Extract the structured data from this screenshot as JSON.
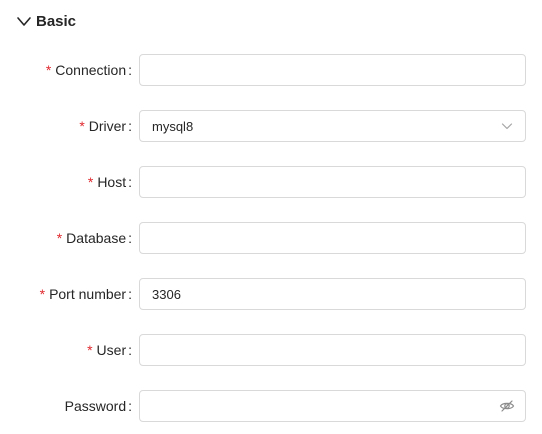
{
  "section": {
    "title": "Basic",
    "expand_icon": "chevron-down-icon"
  },
  "fields": {
    "connection": {
      "label": "Connection",
      "required": "*",
      "colon": ":",
      "value": ""
    },
    "driver": {
      "label": "Driver",
      "required": "*",
      "colon": ":",
      "value": "mysql8",
      "suffix_icon": "chevron-down-icon"
    },
    "host": {
      "label": "Host",
      "required": "*",
      "colon": ":",
      "value": ""
    },
    "database": {
      "label": "Database",
      "required": "*",
      "colon": ":",
      "value": ""
    },
    "port": {
      "label": "Port number",
      "required": "*",
      "colon": ":",
      "value": "3306"
    },
    "user": {
      "label": "User",
      "required": "*",
      "colon": ":",
      "value": ""
    },
    "password": {
      "label": "Password",
      "colon": ":",
      "value": "",
      "suffix_icon": "eye-invisible-icon"
    }
  },
  "colors": {
    "required": "#e0282e",
    "border": "#d9d9d9",
    "text": "#262626"
  }
}
